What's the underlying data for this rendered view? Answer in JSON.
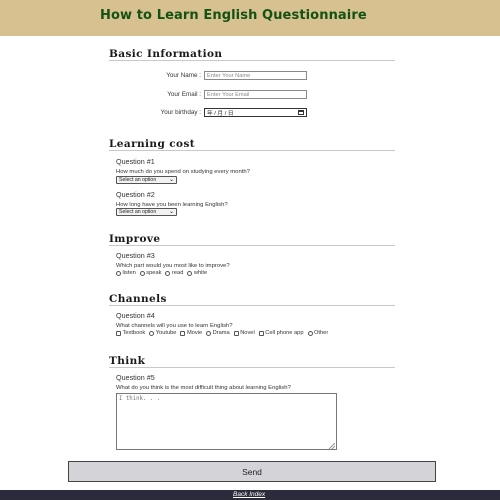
{
  "page": {
    "title": "How to Learn English Questionnaire"
  },
  "basic": {
    "title": "Basic Information",
    "name_label": "Your Name :",
    "name_placeholder": "Enter Your Name",
    "email_label": "Your Email :",
    "email_placeholder": "Enter Your Email",
    "birthday_label": "Your birthday :",
    "birthday_value": "年 / 月 / 日"
  },
  "cost": {
    "title": "Learning cost",
    "q1_title": "Question #1",
    "q1_text": "How much do you spend on studying every month?",
    "q1_select": "Select an option",
    "q2_title": "Question #2",
    "q2_text": "How long have you been learning English?",
    "q2_select": "Select an option"
  },
  "improve": {
    "title": "Improve",
    "q3_title": "Question #3",
    "q3_text": "Which part would you most like to improve?",
    "options": [
      "listen",
      "speak",
      "read",
      "white"
    ]
  },
  "channels": {
    "title": "Channels",
    "q4_title": "Question #4",
    "q4_text": "What channels will you use to learn English?",
    "options": [
      "Textbook",
      "Youtube",
      "Movie",
      "Drama",
      "Novel",
      "Cell phone app",
      "Other"
    ]
  },
  "think": {
    "title": "Think",
    "q5_title": "Question #5",
    "q5_text": "What do you think is the most difficult thing about learning English?",
    "placeholder": "I think. . ."
  },
  "send_label": "Send",
  "footer": {
    "link": "Back Index"
  }
}
